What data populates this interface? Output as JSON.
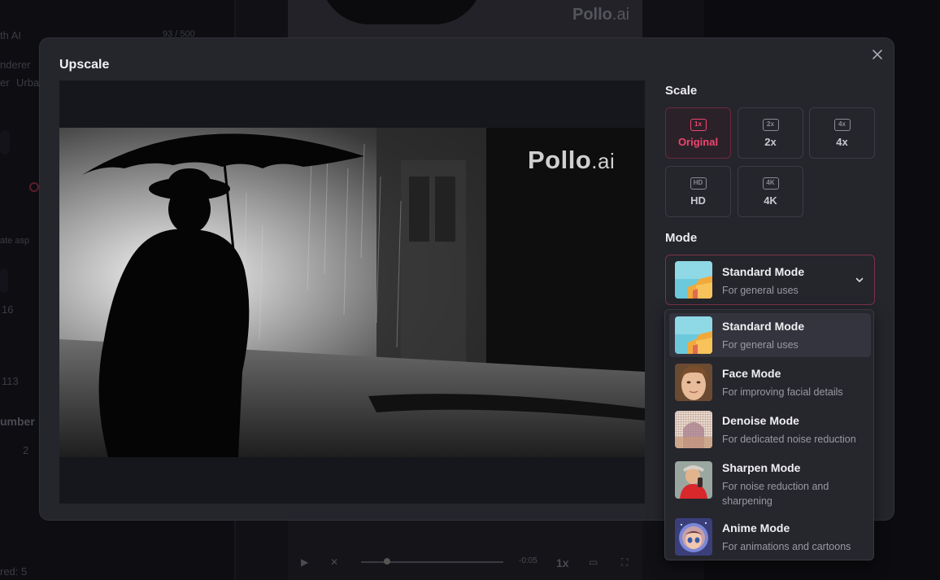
{
  "background": {
    "prompt_fragment": "th AI",
    "char_count": "93 / 500",
    "tags": [
      "nderer",
      "er",
      "Urba"
    ],
    "aspect_hint": "ate asp",
    "num_16": "16",
    "seed_fragment": "113",
    "number_heading": "umber",
    "number_value": "2",
    "credits": "red: 5",
    "watermark_logo": "Pollo",
    "watermark_logo_suffix": ".ai",
    "video_time": "-0:05",
    "video_speed": "1x"
  },
  "modal": {
    "title": "Upscale",
    "close_icon": "close-icon",
    "preview": {
      "watermark_brand": "Pollo",
      "watermark_suffix": ".ai"
    },
    "scale": {
      "label": "Scale",
      "options": [
        {
          "icon_text": "1x",
          "label": "Original",
          "active": true
        },
        {
          "icon_text": "2x",
          "label": "2x",
          "active": false
        },
        {
          "icon_text": "4x",
          "label": "4x",
          "active": false
        },
        {
          "icon_text": "HD",
          "label": "HD",
          "active": false
        },
        {
          "icon_text": "4K",
          "label": "4K",
          "active": false
        }
      ]
    },
    "mode": {
      "label": "Mode",
      "selected": {
        "name": "Standard Mode",
        "desc": "For general uses"
      },
      "options": [
        {
          "name": "Standard Mode",
          "desc": "For general uses",
          "thumb": "standard-thumbnail"
        },
        {
          "name": "Face Mode",
          "desc": "For improving facial details",
          "thumb": "face-thumbnail"
        },
        {
          "name": "Denoise Mode",
          "desc": "For dedicated noise reduction",
          "thumb": "denoise-thumbnail"
        },
        {
          "name": "Sharpen Mode",
          "desc": "For noise reduction and sharpening",
          "thumb": "sharpen-thumbnail"
        },
        {
          "name": "Anime Mode",
          "desc": "For animations and cartoons",
          "thumb": "anime-thumbnail"
        }
      ]
    }
  },
  "colors": {
    "accent": "#f0456f",
    "modal_bg": "#25252c",
    "page_bg": "#0c0c10"
  }
}
